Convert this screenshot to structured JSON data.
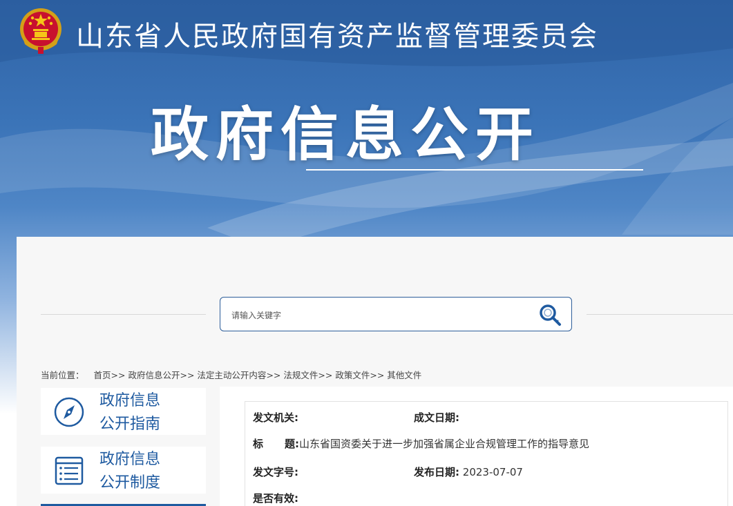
{
  "header": {
    "site_title": "山东省人民政府国有资产监督管理委员会",
    "page_title": "政府信息公开"
  },
  "search": {
    "placeholder": "请输入关键字",
    "icon": "search-icon"
  },
  "breadcrumb": {
    "label": "当前位置：",
    "items": [
      "首页",
      "政府信息公开",
      "法定主动公开内容",
      "法规文件",
      "政策文件",
      "其他文件"
    ],
    "separator": ">>"
  },
  "sidebar": {
    "items": [
      {
        "line1": "政府信息",
        "line2": "公开指南",
        "icon": "compass-icon"
      },
      {
        "line1": "政府信息",
        "line2": "公开制度",
        "icon": "document-list-icon"
      }
    ]
  },
  "document_info": {
    "issuer_label": "发文机关:",
    "issuer_value": "",
    "created_label": "成文日期:",
    "created_value": "",
    "title_label_1": "标",
    "title_label_2": "题:",
    "title_value": "山东省国资委关于进一步加强省属企业合规管理工作的指导意见",
    "doc_no_label": "发文字号:",
    "doc_no_value": "",
    "published_label": "发布日期:",
    "published_value": "2023-07-07",
    "valid_label": "是否有效:",
    "valid_value": ""
  },
  "colors": {
    "banner_blue": "#2f63a6",
    "accent_blue": "#1e5aa0",
    "panel_bg": "#f7f7f7"
  }
}
